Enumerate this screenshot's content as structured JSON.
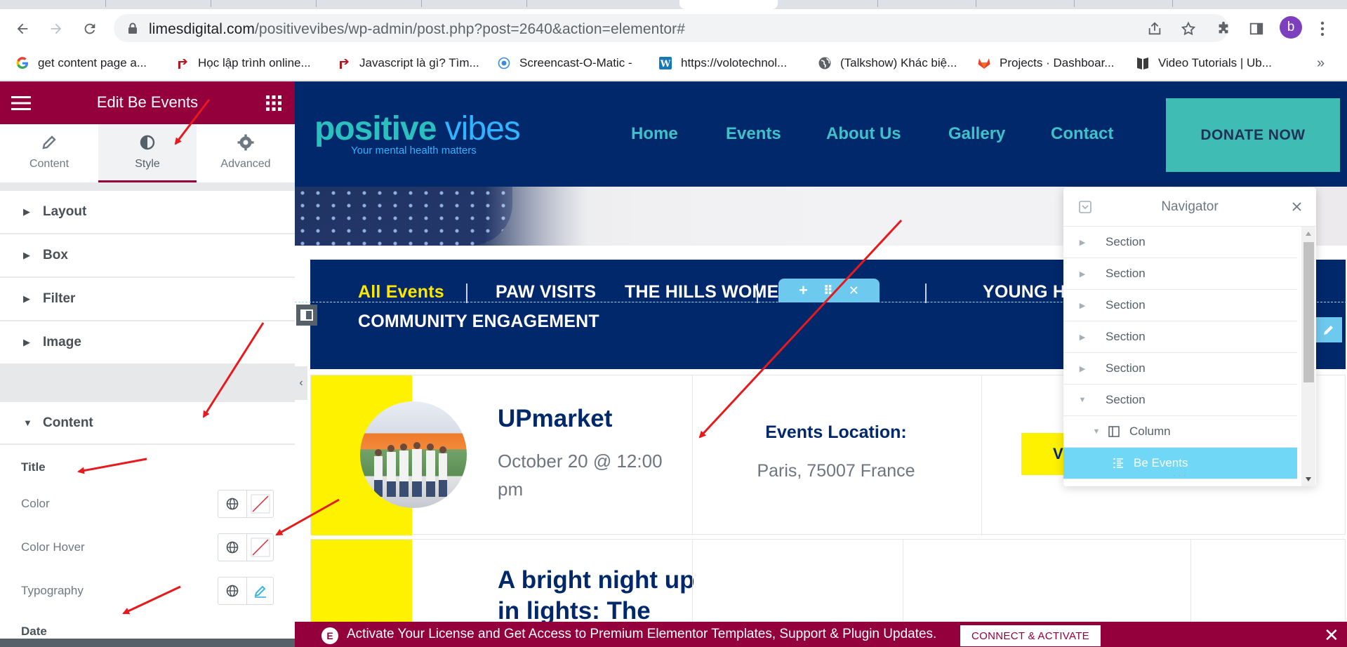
{
  "browser": {
    "url_host": "limesdigital.com",
    "url_path": "/positivevibes/wp-admin/post.php?post=2640&action=elementor#",
    "profile_initial": "b",
    "bookmarks": [
      {
        "label": "get content page a...",
        "icon": "google-icon"
      },
      {
        "label": "Học lập trình online...",
        "icon": "red-arrow-icon"
      },
      {
        "label": "Javascript là gì? Tìm...",
        "icon": "red-arrow-icon"
      },
      {
        "label": "Screencast-O-Matic -",
        "icon": "screencast-icon"
      },
      {
        "label": "https://volotechnol...",
        "icon": "wordpress-icon"
      },
      {
        "label": "(Talkshow) Khác biệ...",
        "icon": "globe-icon"
      },
      {
        "label": "Projects · Dashboar...",
        "icon": "gitlab-icon"
      },
      {
        "label": "Video Tutorials | Ub...",
        "icon": "ubuntu-book-icon"
      }
    ],
    "more_bookmarks": "»"
  },
  "panel": {
    "title": "Edit Be Events",
    "tabs": [
      {
        "label": "Content",
        "icon": "pencil-icon"
      },
      {
        "label": "Style",
        "icon": "half-circle-icon"
      },
      {
        "label": "Advanced",
        "icon": "gear-icon"
      }
    ],
    "sections": [
      {
        "label": "Layout"
      },
      {
        "label": "Box"
      },
      {
        "label": "Filter"
      },
      {
        "label": "Image"
      },
      {
        "label": "Content"
      }
    ],
    "content_controls": {
      "title_heading": "Title",
      "color_label": "Color",
      "color_hover_label": "Color Hover",
      "typography_label": "Typography",
      "date_heading": "Date"
    }
  },
  "site": {
    "logo_positive": "positive",
    "logo_vibes": "vibes",
    "logo_tagline": "Your mental health matters",
    "nav": [
      "Home",
      "Events",
      "About Us",
      "Gallery",
      "Contact"
    ],
    "donate_label": "DONATE NOW",
    "event_tabs": [
      "All Events",
      "PAW VISITS",
      "THE HILLS WOMEN'S SHED",
      "YOUNG HEA",
      "COMMUNITY ENGAGEMENT"
    ],
    "handle_icons": [
      "+",
      "⠿",
      "✕"
    ],
    "events": [
      {
        "title": "UPmarket",
        "date": "October 20 @ 12:00 pm",
        "location_heading": "Events Location:",
        "location": "Paris, 75007 France",
        "button": "VIEW"
      },
      {
        "title_line1": "A bright night up",
        "title_line2": "in lights: The"
      }
    ]
  },
  "navigator": {
    "title": "Navigator",
    "items": [
      {
        "label": "Section",
        "caret": "▶"
      },
      {
        "label": "Section",
        "caret": "▶"
      },
      {
        "label": "Section",
        "caret": "▶"
      },
      {
        "label": "Section",
        "caret": "▶"
      },
      {
        "label": "Section",
        "caret": "▶"
      },
      {
        "label": "Section",
        "caret": "▼"
      },
      {
        "label": "Column",
        "caret": "▼"
      },
      {
        "label": "Be Events",
        "caret": ""
      }
    ],
    "dots": "···"
  },
  "license": {
    "text": "Activate Your License and Get Access to Premium Elementor Templates, Support & Plugin Updates.",
    "button": "CONNECT & ACTIVATE",
    "close": "✕"
  },
  "colors": {
    "elementor_brand": "#93003c",
    "site_navy": "#00286a",
    "site_teal": "#3fc1c9",
    "event_yellow": "#fff200",
    "navigator_active": "#71d7f7",
    "annotation_red": "#e8191d"
  }
}
